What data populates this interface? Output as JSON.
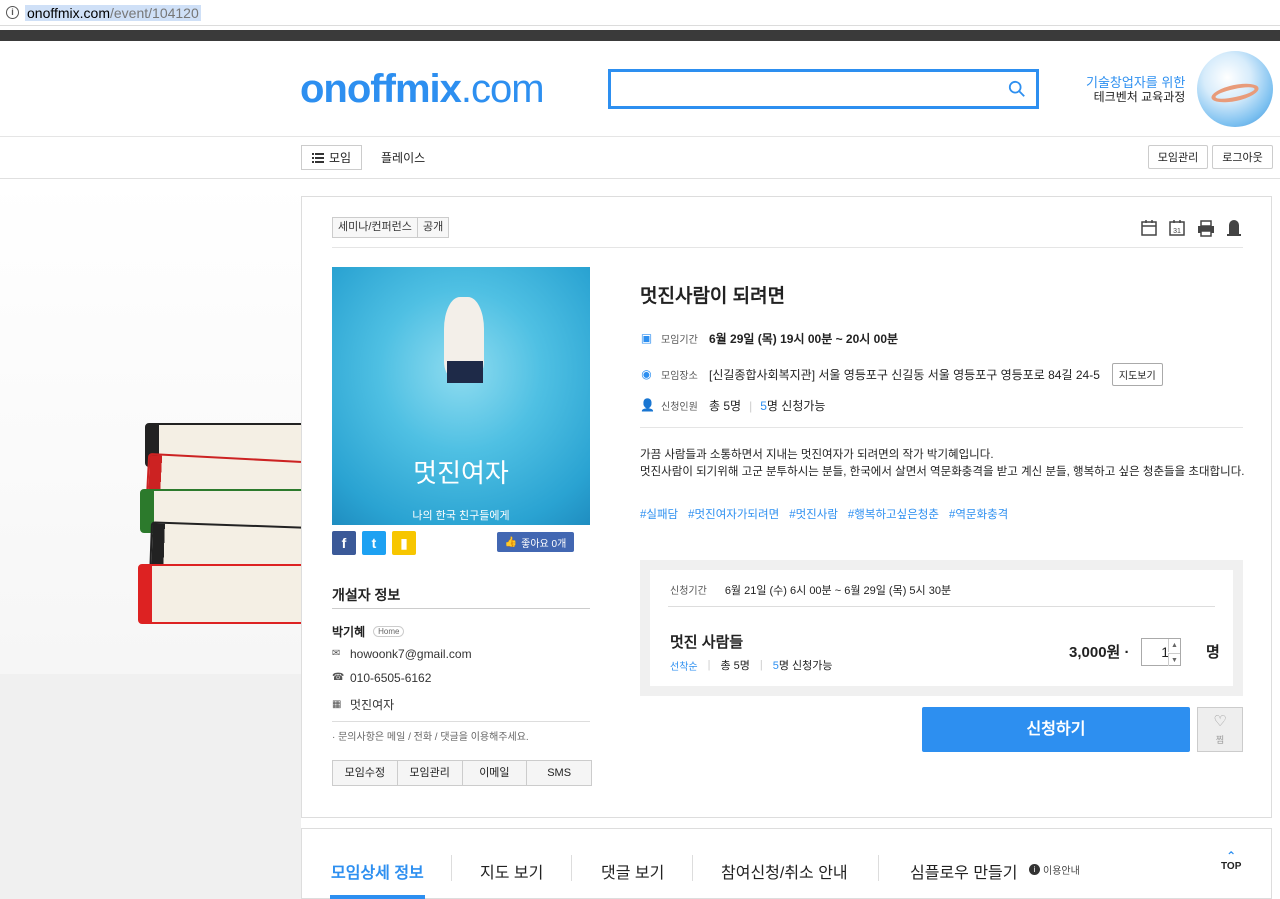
{
  "browser": {
    "url_domain": "onoffmix.com",
    "url_path": "/event/104120"
  },
  "header": {
    "logo": "onoffmix",
    "logo_suffix": ".com",
    "search_placeholder": "",
    "ad_line1": "기술창업자를 위한",
    "ad_line2": "테크벤처 교육과정"
  },
  "nav": {
    "moim_label": "모임",
    "place_label": "플레이스",
    "manage_label": "모임관리",
    "logout_label": "로그아웃"
  },
  "event": {
    "tags": [
      "세미나/컨퍼런스",
      "공개"
    ],
    "cover_title": "멋진여자",
    "cover_subtitle": "나의 한국 친구들에게",
    "title": "멋진사람이 되려면",
    "period_label": "모임기간",
    "period_value": "6월 29일 (목) 19시 00분 ~ 20시 00분",
    "place_label": "모임장소",
    "place_value": "[신길종합사회복지관] 서울 영등포구 신길동 서울 영등포구 영등포로 84길 24-5",
    "map_button": "지도보기",
    "people_label": "신청인원",
    "people_total": "총 5명",
    "people_available_num": "5",
    "people_available": "명 신청가능",
    "desc_line1": "가끔 사람들과 소통하면서 지내는 멋진여자가 되려면의 작가 박기혜입니다.",
    "desc_line2": "멋진사람이 되기위해 고군 분투하시는 분들, 한국에서 살면서 역문화충격을 받고 계신 분들, 행복하고 싶은 청춘들을 초대합니다.",
    "hashtags": [
      "#실패담",
      "#멋진여자가되려면",
      "#멋진사람",
      "#행복하고싶은청춘",
      "#역문화충격"
    ],
    "like_label": "좋아요 0개"
  },
  "host": {
    "section_title": "개설자 정보",
    "name": "박기혜",
    "home_badge": "Home",
    "email": "howoonk7@gmail.com",
    "phone": "010-6505-6162",
    "company": "멋진여자",
    "note": "· 문의사항은 메일 / 전화 / 댓글을 이용해주세요.",
    "buttons": [
      "모임수정",
      "모임관리",
      "이메일",
      "SMS"
    ]
  },
  "ticket": {
    "period_label": "신청기간",
    "period_value": "6월 21일 (수) 6시 00분 ~ 6월 29일 (목) 5시 30분",
    "name": "멋진 사람들",
    "order": "선착순",
    "total": "총 5명",
    "available_num": "5",
    "available": "명 신청가능",
    "price": "3,000원 ·",
    "quantity": "1",
    "unit": "명"
  },
  "actions": {
    "apply": "신청하기",
    "wish": "찜"
  },
  "tabs": {
    "items": [
      "모임상세 정보",
      "지도 보기",
      "댓글 보기",
      "참여신청/취소 안내",
      "심플로우 만들기"
    ],
    "use_info": "이용안내",
    "top": "TOP"
  },
  "colors": {
    "brand": "#2d8ff0",
    "facebook": "#3b5998",
    "twitter": "#1da1f2",
    "kakao": "#f7c600"
  }
}
